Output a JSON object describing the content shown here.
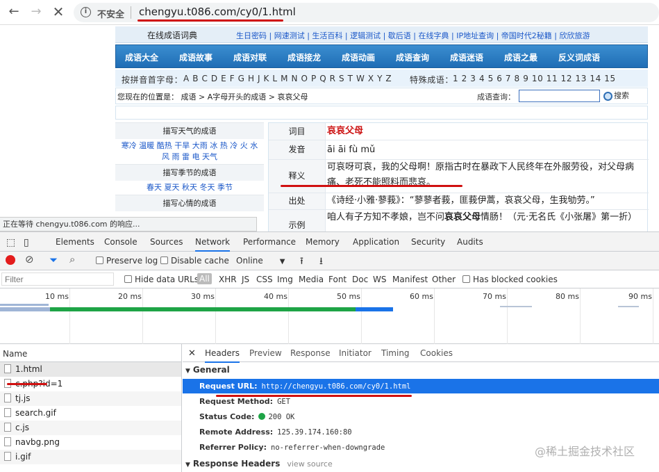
{
  "browser": {
    "security_label": "不安全",
    "url": "chengyu.t086.com/cy0/1.html",
    "status_text": "正在等待 chengyu.t086.com 的响应..."
  },
  "page": {
    "site_title": "在线成语词典",
    "top_links": "生日密码 | 网速测试 | 生活百科 | 逻辑测试 | 歇后语 | 在线字典 | IP地址查询 | 帝国时代2秘籍 | 欣欣旅游",
    "nav": [
      "成语大全",
      "成语故事",
      "成语对联",
      "成语接龙",
      "成语动画",
      "成语查询",
      "成语迷语",
      "成语之最",
      "反义词成语"
    ],
    "pinyin_label": "按拼音首字母：",
    "letters": "A B C D E F G H J K L M N O P Q R S T W X Y Z",
    "special_label": "特殊成语：",
    "special_numbers": "1 2 3 4 5 6 7 8 9 10 11 12 13 14 15",
    "breadcrumb": "您现在的位置是： 成语 > A字母开头的成语 > 哀哀父母",
    "query_label": "成语查询：",
    "search_label": "搜索",
    "left": [
      {
        "heading": "描写天气的成语",
        "words": "寒冷 温暖 酷热 干旱 大雨 冰 热 冷 火 水 风 雨 雷 电 天气"
      },
      {
        "heading": "描写季节的成语",
        "words": "春天 夏天 秋天 冬天 季节"
      },
      {
        "heading": "描写心情的成语",
        "words": ""
      }
    ],
    "entry": {
      "k_word": "词目",
      "word": "哀哀父母",
      "k_pron": "发音",
      "pron": "āi āi fù mǔ",
      "k_meaning": "释义",
      "meaning": "可哀呀可哀，我的父母啊！原指古时在暴政下人民终年在外服劳役，对父母病痛、老死不能照料而悲哀。",
      "k_source": "出处",
      "source": "《诗经·小雅·蓼莪》：“蓼蓼者莪，匪莪伊蒿，哀哀父母，生我劬劳。”",
      "k_example": "示例",
      "example_pre": "咱人有子方知不孝娘，岂不问",
      "example_bold": "哀哀父母",
      "example_post": "情肠！（元·无名氏《小张屠》第一折）"
    }
  },
  "devtools": {
    "tabs": [
      "Elements",
      "Console",
      "Sources",
      "Network",
      "Performance",
      "Memory",
      "Application",
      "Security",
      "Audits"
    ],
    "active_tab": "Network",
    "preserve_log": "Preserve log",
    "disable_cache": "Disable cache",
    "throttle": "Online",
    "filter_placeholder": "Filter",
    "hide_data_urls": "Hide data URLs",
    "type_filters": [
      "All",
      "XHR",
      "JS",
      "CSS",
      "Img",
      "Media",
      "Font",
      "Doc",
      "WS",
      "Manifest",
      "Other"
    ],
    "has_blocked": "Has blocked cookies",
    "timeline_labels": [
      "10 ms",
      "20 ms",
      "30 ms",
      "40 ms",
      "50 ms",
      "60 ms",
      "70 ms",
      "80 ms",
      "90 ms"
    ],
    "name_header": "Name",
    "requests": [
      "1.html",
      "c.php?id=1",
      "tj.js",
      "search.gif",
      "c.js",
      "navbg.png",
      "i.gif"
    ],
    "detail_tabs": [
      "Headers",
      "Preview",
      "Response",
      "Initiator",
      "Timing",
      "Cookies"
    ],
    "general_label": "General",
    "general": {
      "url_key": "Request URL:",
      "url_val": "http://chengyu.t086.com/cy0/1.html",
      "method_key": "Request Method:",
      "method_val": "GET",
      "status_key": "Status Code:",
      "status_val": "200 OK",
      "remote_key": "Remote Address:",
      "remote_val": "125.39.174.160:80",
      "referrer_key": "Referrer Policy:",
      "referrer_val": "no-referrer-when-downgrade"
    },
    "response_headers_label": "Response Headers",
    "view_source": "view source"
  },
  "watermark": "@稀土掘金技术社区",
  "colors": {
    "accent": "#1a73e8",
    "red_underline": "#d01010",
    "nav_blue": "#2a7cc4",
    "status_ok": "#1ea446"
  }
}
